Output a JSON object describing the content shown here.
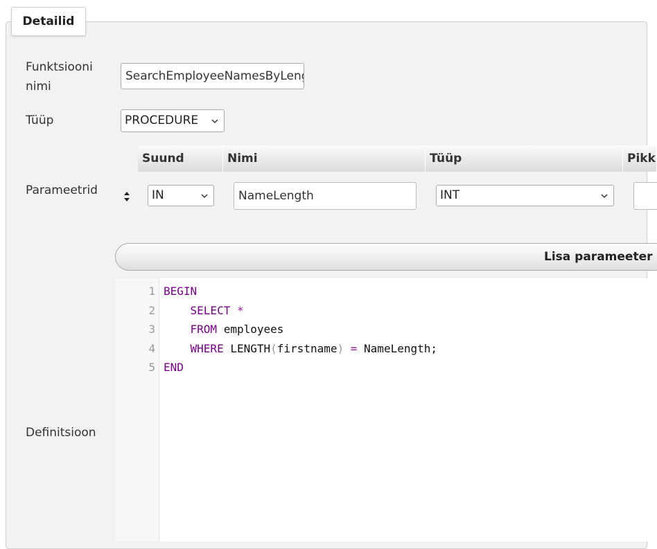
{
  "panel": {
    "title": "Detailid"
  },
  "form": {
    "function_name_label": "Funktsiooni nimi",
    "function_name_value": "SearchEmployeeNamesByLength",
    "type_label": "Tüüp",
    "type_value": "PROCEDURE",
    "params_label": "Parameetrid",
    "definition_label": "Definitsioon"
  },
  "params_table": {
    "headers": [
      "Suund",
      "Nimi",
      "Tüüp",
      "Pikkus"
    ],
    "rows": [
      {
        "direction": "IN",
        "name": "NameLength",
        "type": "INT",
        "length": ""
      }
    ],
    "add_button_label": "Lisa parameeter"
  },
  "editor": {
    "line_numbers": [
      "1",
      "2",
      "3",
      "4",
      "5"
    ],
    "lines": [
      [
        {
          "t": "BEGIN",
          "c": "kw"
        }
      ],
      [
        {
          "t": "    ",
          "c": ""
        },
        {
          "t": "SELECT",
          "c": "kw"
        },
        {
          "t": " ",
          "c": ""
        },
        {
          "t": "*",
          "c": "op"
        }
      ],
      [
        {
          "t": "    ",
          "c": ""
        },
        {
          "t": "FROM",
          "c": "kw"
        },
        {
          "t": " employees",
          "c": ""
        }
      ],
      [
        {
          "t": "    ",
          "c": ""
        },
        {
          "t": "WHERE",
          "c": "kw"
        },
        {
          "t": " LENGTH",
          "c": ""
        },
        {
          "t": "(",
          "c": "br"
        },
        {
          "t": "firstname",
          "c": ""
        },
        {
          "t": ")",
          "c": "br"
        },
        {
          "t": " ",
          "c": ""
        },
        {
          "t": "=",
          "c": "op"
        },
        {
          "t": " NameLength;",
          "c": ""
        }
      ],
      [
        {
          "t": "END",
          "c": "kw"
        }
      ]
    ]
  },
  "icons": {
    "drag_handle": "sort-arrows-icon",
    "dropdown": "chevron-down-icon"
  }
}
